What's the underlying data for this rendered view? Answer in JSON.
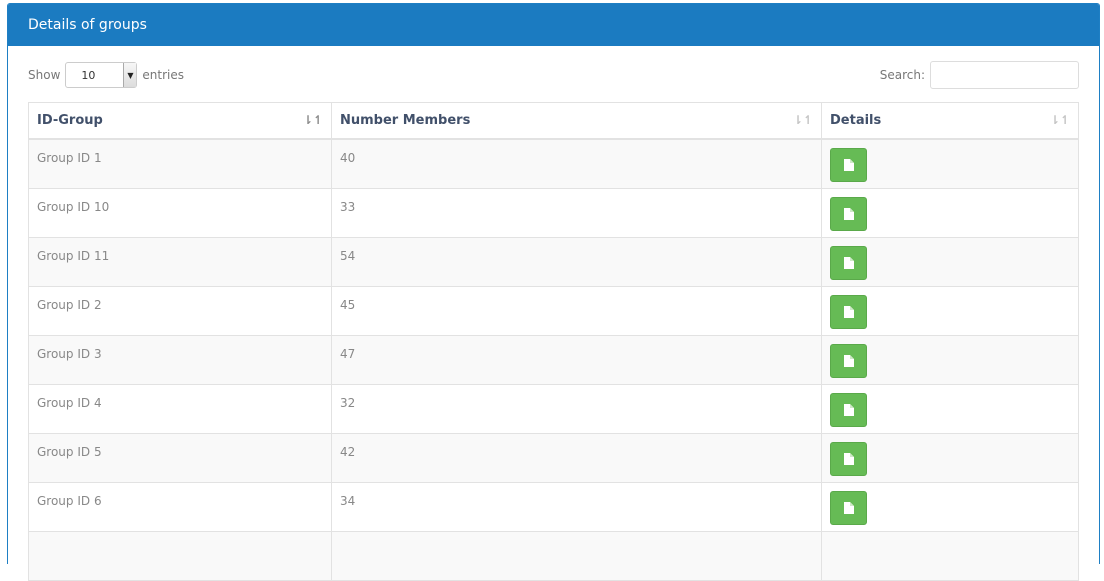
{
  "panel": {
    "title": "Details of groups",
    "header_color": "#1b7bc1"
  },
  "length_control": {
    "show_label": "Show",
    "selected": "10",
    "entries_label": "entries"
  },
  "search": {
    "label": "Search:",
    "value": ""
  },
  "table": {
    "columns": [
      "ID-Group",
      "Number Members",
      "Details"
    ],
    "sorted_column": "ID-Group",
    "rows": [
      {
        "id": "Group ID 1",
        "members": "40"
      },
      {
        "id": "Group ID 10",
        "members": "33"
      },
      {
        "id": "Group ID 11",
        "members": "54"
      },
      {
        "id": "Group ID 2",
        "members": "45"
      },
      {
        "id": "Group ID 3",
        "members": "47"
      },
      {
        "id": "Group ID 4",
        "members": "32"
      },
      {
        "id": "Group ID 5",
        "members": "42"
      },
      {
        "id": "Group ID 6",
        "members": "34"
      },
      {
        "id": "",
        "members": ""
      }
    ],
    "details_icon": "file-icon",
    "button_color": "#66bb55"
  }
}
